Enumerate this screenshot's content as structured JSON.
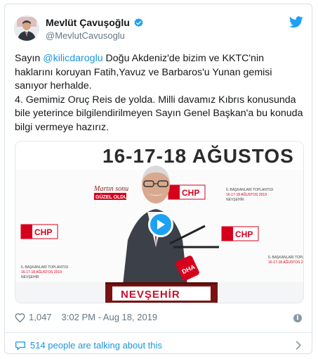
{
  "user": {
    "name": "Mevlüt Çavuşoğlu",
    "handle": "@MevlutCavusoglu"
  },
  "tweet": {
    "text_before_mention": "Sayın ",
    "mention": "@kilicdaroglu",
    "text_after_mention": " Doğu Akdeniz'de bizim ve KKTC'nin haklarını koruyan Fatih,Yavuz ve Barbaros'u Yunan gemisi sanıyor herhalde.",
    "line2": "4. Gemimiz Oruç Reis de yolda. Milli davamız Kıbrıs konusunda bile yeterince bilgilendirilmeyen Sayın Genel Başkan'a bu konuda bilgi vermeye hazırız."
  },
  "media": {
    "banner_text": "16-17-18 AĞUSTOS",
    "podium_text": "NEVŞEHİR",
    "logo_text": "CHP",
    "mic_label": "DHA",
    "side_sign_line1": "İL BAŞKANLARI TOPLANTISI",
    "side_sign_line2": "16-17-18 AĞUSTOS 2019",
    "side_sign_line3": "NEVŞEHİR",
    "slogan_line1": "Martın sonu",
    "slogan_line2": "GÜZEL OLDU",
    "media_type": "video"
  },
  "meta": {
    "likes": "1,047",
    "timestamp": "3:02 PM - Aug 18, 2019"
  },
  "footer": {
    "talking": "514 people are talking about this"
  },
  "colors": {
    "accent": "#1da1f2",
    "link": "#1b95e0",
    "muted": "#657786",
    "chp_red": "#d6001c"
  },
  "icons": [
    "verified-badge-icon",
    "twitter-bird-icon",
    "play-icon",
    "heart-icon",
    "info-icon",
    "speech-bubble-icon",
    "chevron-right-icon"
  ]
}
